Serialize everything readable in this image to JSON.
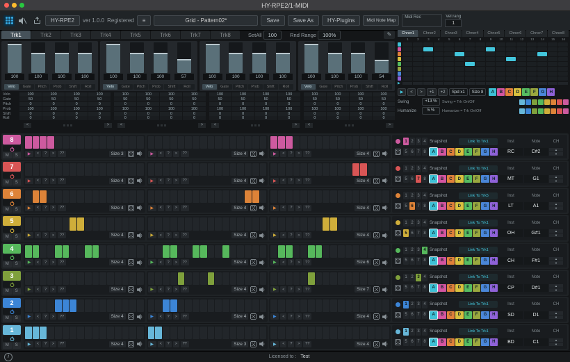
{
  "window": {
    "title": "HY-RPE2/1-MIDI"
  },
  "toolbar": {
    "plugin_button": "HY-RPE2",
    "version": "ver 1.0.0",
    "registered": "Registered",
    "menu_icon": "≡",
    "pattern_selector": "Grid - Pattern02*",
    "save": "Save",
    "save_as": "Save As",
    "hy_plugins": "HY-Plugins",
    "midi_note_map": "Midi Note Map",
    "midi_rec": "Midi Rec",
    "vel_rang_label": "Vel:rang",
    "vel_rang_value": "1"
  },
  "track_tabs": {
    "tabs": [
      "Trk1",
      "Trk2",
      "Trk3",
      "Trk4",
      "Trk5",
      "Trk6",
      "Trk7",
      "Trk8"
    ],
    "selected": 0,
    "setall_label": "SetAll",
    "setall_value": "100",
    "rnd_range_label": "Rnd Range",
    "rnd_range_value": "100%"
  },
  "mixer": {
    "param_tabs": [
      "Velo",
      "Gate",
      "Pitch",
      "Prob",
      "Shift",
      "Roll"
    ],
    "selected_param": 0,
    "groups": [
      {
        "faders": [
          {
            "value": "100",
            "fill": 92
          },
          {
            "value": "100",
            "fill": 62
          },
          {
            "value": "100",
            "fill": 62
          },
          {
            "value": "100",
            "fill": 62
          }
        ]
      },
      {
        "faders": [
          {
            "value": "100",
            "fill": 92
          },
          {
            "value": "100",
            "fill": 62
          },
          {
            "value": "100",
            "fill": 62
          },
          {
            "value": "57",
            "fill": 40
          }
        ]
      },
      {
        "faders": [
          {
            "value": "100",
            "fill": 92
          },
          {
            "value": "100",
            "fill": 62
          },
          {
            "value": "100",
            "fill": 62
          },
          {
            "value": "100",
            "fill": 62
          }
        ]
      },
      {
        "faders": [
          {
            "value": "100",
            "fill": 92
          },
          {
            "value": "100",
            "fill": 62
          },
          {
            "value": "100",
            "fill": 62
          },
          {
            "value": "54",
            "fill": 38
          }
        ]
      }
    ],
    "value_rows": [
      {
        "label": "Velo",
        "values": [
          "100",
          "100",
          "100",
          "100",
          "100",
          "100",
          "100",
          "100",
          "100",
          "100",
          "100",
          "100",
          "100",
          "100",
          "100",
          "100"
        ]
      },
      {
        "label": "Gate",
        "values": [
          "50",
          "50",
          "50",
          "50",
          "50",
          "50",
          "50",
          "50",
          "50",
          "50",
          "50",
          "50",
          "50",
          "50",
          "50",
          "50"
        ]
      },
      {
        "label": "Pitch",
        "values": [
          "0",
          "0",
          "0",
          "0",
          "0",
          "0",
          "0",
          "0",
          "0",
          "0",
          "0",
          "0",
          "0",
          "0",
          "0",
          "0"
        ]
      },
      {
        "label": "Prob",
        "values": [
          "100",
          "100",
          "100",
          "100",
          "100",
          "100",
          "100",
          "100",
          "100",
          "100",
          "100",
          "100",
          "100",
          "100",
          "100",
          "100"
        ]
      },
      {
        "label": "Shift",
        "values": [
          "0",
          "0",
          "0",
          "0",
          "0",
          "0",
          "0",
          "0",
          "0",
          "0",
          "0",
          "0",
          "0",
          "0",
          "0",
          "0"
        ]
      },
      {
        "label": "Roll",
        "values": [
          "0",
          "0",
          "0",
          "0",
          "0",
          "0",
          "0",
          "0",
          "0",
          "0",
          "0",
          "0",
          "0",
          "0",
          "0",
          "0"
        ]
      }
    ]
  },
  "chainer": {
    "tabs": [
      "Chner1",
      "Chner2",
      "Chner3",
      "Chner4",
      "Chner5",
      "Chner6",
      "Chner7",
      "Chner8"
    ],
    "selected_tab": 0,
    "col_numbers": [
      "1",
      "2",
      "3",
      "4",
      "5",
      "6",
      "7",
      "8",
      "9",
      "10",
      "11",
      "12",
      "13",
      "14",
      "15",
      "16"
    ],
    "rows": 8,
    "cols": 16,
    "active_cells": [
      [
        1,
        2
      ],
      [
        2,
        5
      ],
      [
        1,
        8
      ],
      [
        3,
        10
      ],
      [
        2,
        13
      ],
      [
        4,
        6
      ]
    ],
    "controls": {
      "play": "▶",
      "prev": "<",
      "next": ">",
      "jump1": "+1",
      "jump2": "+2",
      "speed": "Spd x1",
      "size": "Size 8"
    },
    "letters": [
      "A",
      "B",
      "C",
      "D",
      "E",
      "F",
      "G",
      "H"
    ],
    "letter_colors": [
      "#3ec1d6",
      "#d455a0",
      "#e0813a",
      "#d9c13f",
      "#57bd61",
      "#9aa83f",
      "#4a86d8",
      "#8f62d8"
    ],
    "swing": {
      "label": "Swing",
      "value": "+13 %",
      "toggle_label": "Swing = Trk On/Off"
    },
    "humanize": {
      "label": "Humanize",
      "value": "5 %",
      "toggle_label": "Humanize = Trk On/Off"
    },
    "track_toggle_colors": [
      "#67b7d9",
      "#3c85d6",
      "#7fa03c",
      "#56b85c",
      "#cfae3a",
      "#dd8338",
      "#d85555",
      "#cd5a9f"
    ]
  },
  "sequencer": {
    "slot_numbers": [
      "1",
      "2",
      "3",
      "4",
      "5",
      "6",
      "7",
      "8"
    ],
    "snapshot_label": "Snapshot",
    "inst_header": "Inst",
    "note_header": "Note",
    "ch_header": "CH",
    "lane_buttons": {
      "play": "▶",
      "left": "<",
      "rand": "?",
      "right": ">",
      "rand_all": "??"
    },
    "tracks": [
      {
        "num": "8",
        "color": "#cd5a9f",
        "mute": "M",
        "solo": "S",
        "selected_slot": 1,
        "selected_letter": 0,
        "link": "Link To Trk1",
        "inst": "RC",
        "note": "C#2",
        "lanes": [
          {
            "size": "Size 3",
            "steps": [
              1,
              1,
              1,
              1,
              0,
              0,
              0,
              0,
              0,
              0,
              0,
              0,
              0,
              0,
              0,
              0
            ]
          },
          {
            "size": "Size 4",
            "steps": [
              0,
              0,
              0,
              0,
              0,
              0,
              0,
              0,
              0,
              0,
              0,
              0,
              0,
              0,
              0,
              0
            ]
          },
          {
            "size": "Size 4",
            "steps": [
              1,
              1,
              1,
              0,
              0,
              0,
              0,
              0,
              0,
              0,
              0,
              0,
              0,
              0,
              0,
              0
            ]
          }
        ]
      },
      {
        "num": "7",
        "color": "#d85555",
        "mute": "M",
        "solo": "S",
        "selected_slot": 7,
        "selected_letter": 0,
        "link": "Link To Trk1",
        "inst": "MT",
        "note": "G1",
        "lanes": [
          {
            "size": "Size 4",
            "steps": [
              0,
              0,
              0,
              0,
              0,
              0,
              0,
              0,
              0,
              0,
              0,
              0,
              0,
              0,
              0,
              0
            ]
          },
          {
            "size": "Size 4",
            "steps": [
              0,
              0,
              0,
              0,
              0,
              0,
              0,
              0,
              0,
              0,
              0,
              0,
              0,
              0,
              0,
              0
            ]
          },
          {
            "size": "Size 4",
            "steps": [
              0,
              0,
              0,
              0,
              0,
              0,
              0,
              0,
              0,
              0,
              0,
              1,
              1,
              0,
              0,
              0
            ]
          }
        ]
      },
      {
        "num": "6",
        "color": "#dd8338",
        "mute": "M",
        "solo": "S",
        "selected_slot": 6,
        "selected_letter": 0,
        "link": "Link To Trk5",
        "inst": "LT",
        "note": "A1",
        "lanes": [
          {
            "size": "Size 4",
            "steps": [
              0,
              1,
              1,
              0,
              0,
              0,
              0,
              0,
              0,
              0,
              0,
              0,
              0,
              0,
              0,
              0
            ]
          },
          {
            "size": "Size 4",
            "steps": [
              0,
              0,
              0,
              0,
              0,
              0,
              0,
              0,
              0,
              0,
              0,
              0,
              0,
              1,
              1,
              0
            ]
          },
          {
            "size": "Size 4",
            "steps": [
              0,
              0,
              0,
              0,
              0,
              0,
              0,
              0,
              0,
              0,
              0,
              0,
              0,
              0,
              0,
              0
            ]
          }
        ]
      },
      {
        "num": "5",
        "color": "#cfae3a",
        "mute": "M",
        "solo": "S",
        "selected_slot": 5,
        "selected_letter": 0,
        "link": "Link To Trk1",
        "inst": "OH",
        "note": "G#1",
        "lanes": [
          {
            "size": "Size 4",
            "steps": [
              0,
              0,
              0,
              0,
              0,
              0,
              1,
              1,
              0,
              0,
              0,
              0,
              0,
              0,
              0,
              0
            ]
          },
          {
            "size": "Size 4",
            "steps": [
              0,
              0,
              0,
              0,
              0,
              0,
              0,
              0,
              0,
              0,
              0,
              0,
              0,
              0,
              0,
              0
            ]
          },
          {
            "size": "Size 4",
            "steps": [
              0,
              0,
              0,
              0,
              0,
              0,
              0,
              1,
              1,
              0,
              0,
              0,
              0,
              0,
              0,
              0
            ]
          }
        ]
      },
      {
        "num": "4",
        "color": "#56b85c",
        "mute": "M",
        "solo": "S",
        "selected_slot": 4,
        "selected_letter": 0,
        "link": "Link To Trk1",
        "inst": "CH",
        "note": "F#1",
        "lanes": [
          {
            "size": "Size 4",
            "steps": [
              1,
              1,
              0,
              0,
              1,
              1,
              0,
              0,
              1,
              1,
              0,
              0,
              0,
              0,
              0,
              0
            ]
          },
          {
            "size": "Size 4",
            "steps": [
              0,
              0,
              1,
              1,
              0,
              0,
              1,
              1,
              0,
              0,
              1,
              0,
              0,
              0,
              0,
              0
            ]
          },
          {
            "size": "Size 6",
            "steps": [
              0,
              1,
              1,
              0,
              0,
              1,
              1,
              0,
              0,
              0,
              0,
              0,
              0,
              0,
              0,
              0
            ]
          }
        ]
      },
      {
        "num": "3",
        "color": "#7fa03c",
        "mute": "M",
        "solo": "S",
        "selected_slot": 3,
        "selected_letter": 0,
        "link": "Link To Trk1",
        "inst": "CP",
        "note": "D#1",
        "lanes": [
          {
            "size": "Size 4",
            "steps": [
              0,
              0,
              0,
              0,
              0,
              0,
              0,
              0,
              0,
              0,
              0,
              0,
              0,
              0,
              0,
              0
            ]
          },
          {
            "size": "Size 4",
            "steps": [
              0,
              0,
              0,
              0,
              1,
              0,
              0,
              0,
              1,
              0,
              0,
              0,
              0,
              0,
              0,
              0
            ]
          },
          {
            "size": "Size 7",
            "steps": [
              0,
              0,
              0,
              0,
              0,
              1,
              0,
              0,
              0,
              0,
              0,
              0,
              0,
              0,
              0,
              0
            ]
          }
        ]
      },
      {
        "num": "2",
        "color": "#3c85d6",
        "mute": "M",
        "solo": "S",
        "selected_slot": 1,
        "selected_letter": 0,
        "link": "Link To Trk1",
        "inst": "SD",
        "note": "D1",
        "lanes": [
          {
            "size": "Size 4",
            "steps": [
              0,
              0,
              0,
              0,
              1,
              1,
              1,
              0,
              0,
              0,
              0,
              0,
              0,
              0,
              0,
              0
            ]
          },
          {
            "size": "Size 4",
            "steps": [
              0,
              0,
              1,
              1,
              0,
              0,
              0,
              0,
              0,
              0,
              0,
              0,
              0,
              0,
              0,
              0
            ]
          },
          {
            "size": "Size 4",
            "steps": [
              0,
              0,
              0,
              0,
              0,
              0,
              0,
              0,
              0,
              0,
              0,
              0,
              0,
              0,
              0,
              0
            ]
          }
        ]
      },
      {
        "num": "1",
        "color": "#67b7d9",
        "mute": "M",
        "solo": "S",
        "selected_slot": 1,
        "selected_letter": 0,
        "link": "Link To Trk1",
        "inst": "BD",
        "note": "C1",
        "lanes": [
          {
            "size": "Size 4",
            "steps": [
              1,
              1,
              1,
              0,
              0,
              0,
              0,
              0,
              0,
              0,
              0,
              0,
              0,
              0,
              0,
              0
            ]
          },
          {
            "size": "Size 3",
            "steps": [
              1,
              1,
              0,
              0,
              0,
              0,
              0,
              0,
              0,
              0,
              0,
              0,
              0,
              0,
              0,
              0
            ]
          },
          {
            "size": "Size 4",
            "steps": [
              0,
              0,
              0,
              0,
              0,
              0,
              0,
              0,
              0,
              0,
              0,
              0,
              0,
              0,
              0,
              0
            ]
          }
        ]
      }
    ]
  },
  "statusbar": {
    "info_icon": "i",
    "licensed_label": "Licensed to :",
    "licensee": "Test"
  }
}
